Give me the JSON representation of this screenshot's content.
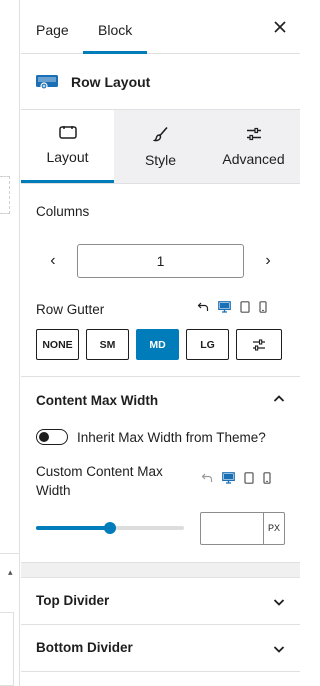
{
  "header": {
    "tabs": [
      {
        "label": "Page",
        "active": false
      },
      {
        "label": "Block",
        "active": true
      }
    ]
  },
  "block": {
    "name": "Row Layout",
    "icon": "row-layout-icon"
  },
  "inner_tabs": [
    {
      "label": "Layout",
      "icon": "layout-icon",
      "active": true
    },
    {
      "label": "Style",
      "icon": "brush-icon",
      "active": false
    },
    {
      "label": "Advanced",
      "icon": "sliders-icon",
      "active": false
    }
  ],
  "columns": {
    "label": "Columns",
    "value": "1",
    "prev": "‹",
    "next": "›"
  },
  "gutter": {
    "label": "Row Gutter",
    "options": [
      "NONE",
      "SM",
      "MD",
      "LG"
    ],
    "selected": "MD"
  },
  "content_max_width": {
    "title": "Content Max Width",
    "toggle_label": "Inherit Max Width from Theme?",
    "toggle_on": false,
    "custom_label": "Custom Content Max Width",
    "slider_value": 0.5,
    "input_value": "",
    "unit": "PX"
  },
  "accordions": [
    {
      "title": "Top Divider"
    },
    {
      "title": "Bottom Divider"
    }
  ],
  "colors": {
    "accent": "#007cba",
    "text": "#1e1e1e",
    "border": "#e0e0e0"
  }
}
